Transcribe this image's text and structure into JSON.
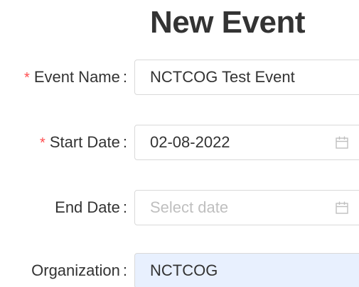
{
  "page": {
    "title": "New Event"
  },
  "form": {
    "event_name": {
      "required_mark": "*",
      "label": "Event Name",
      "colon": ":",
      "value": "NCTCOG Test Event"
    },
    "start_date": {
      "required_mark": "*",
      "label": "Start Date",
      "colon": ":",
      "value": "02-08-2022",
      "icon": "calendar-icon"
    },
    "end_date": {
      "label": "End Date",
      "colon": ":",
      "value": "",
      "placeholder": "Select date",
      "icon": "calendar-icon"
    },
    "organization": {
      "label": "Organization",
      "colon": ":",
      "value": "NCTCOG"
    }
  },
  "colors": {
    "required": "#ff4d4f",
    "autofill_background": "#e8f0fe",
    "border": "#d9d9d9",
    "placeholder": "#bfbfbf",
    "text": "#333333"
  }
}
